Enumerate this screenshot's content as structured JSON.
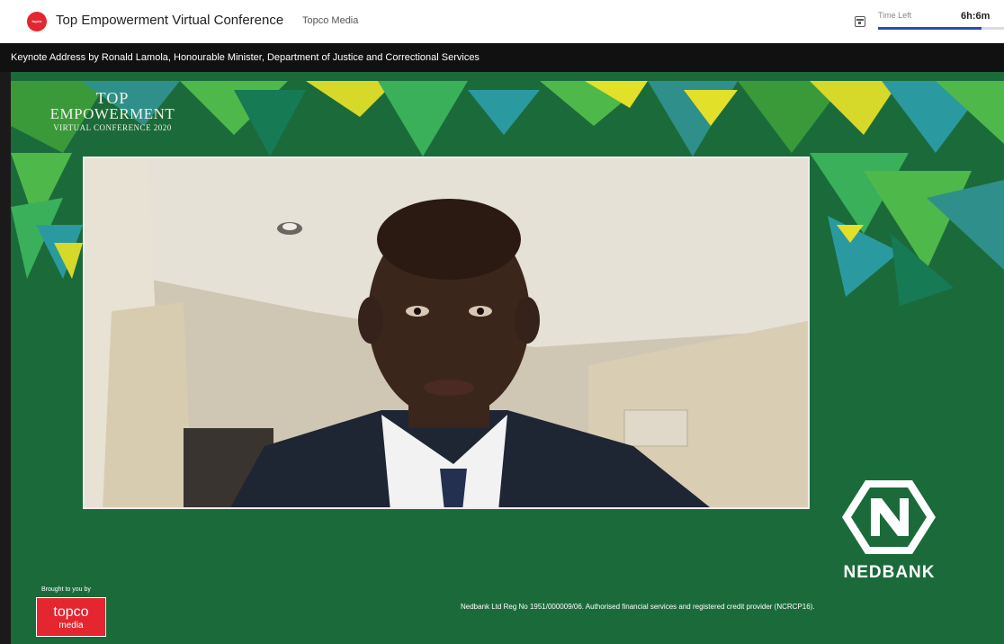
{
  "header": {
    "logo_text": "topco",
    "title": "Top Empowerment Virtual Conference",
    "organizer": "Topco Media",
    "time_left_label": "Time Left",
    "time_left_value": "6h:6m",
    "time_left_progress": 0.82
  },
  "session": {
    "title": "Keynote Address by Ronald Lamola, Honourable Minister, Department of Justice and Correctional Services"
  },
  "stage": {
    "conference_logo": {
      "line1": "TOP",
      "line2": "EMPOWERMENT",
      "line3": "VIRTUAL CONFERENCE 2020"
    },
    "sponsor_name": "NEDBANK",
    "brought_by": "Brought to you by",
    "presenter_logo_line1": "topco",
    "presenter_logo_line2": "media",
    "sponsor_legal": "Nedbank Ltd Reg No 1951/000009/06. Authorised financial services and registered credit provider (NCRCP16)."
  },
  "colors": {
    "brand_red": "#e3262f",
    "stage_green": "#1b6b3a",
    "accent_blue": "#2b4db0"
  }
}
